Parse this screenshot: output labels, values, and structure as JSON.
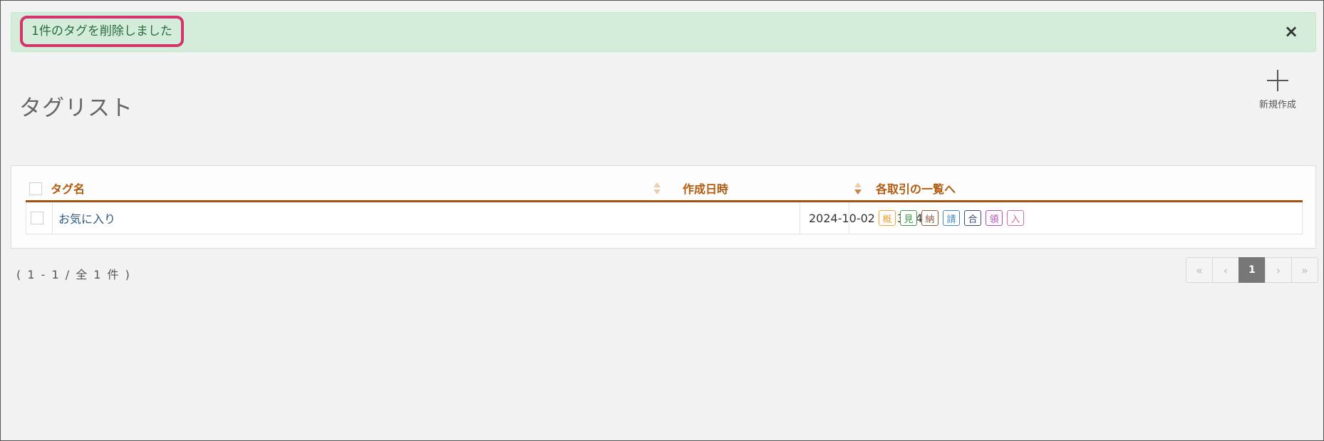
{
  "alert": {
    "message": "1件のタグを削除しました",
    "close": "×"
  },
  "page": {
    "title": "タグリスト",
    "new_button_label": "新規作成"
  },
  "table": {
    "columns": [
      "タグ名",
      "作成日時",
      "各取引の一覧へ"
    ],
    "rows": [
      {
        "name": "お気に入り",
        "created": "2024-10-02 13:37:41",
        "badges": [
          {
            "label": "概",
            "color": "#f0a13a"
          },
          {
            "label": "見",
            "color": "#3f9a4a"
          },
          {
            "label": "納",
            "color": "#8a5a3c"
          },
          {
            "label": "請",
            "color": "#3f86c9"
          },
          {
            "label": "合",
            "color": "#35507a"
          },
          {
            "label": "領",
            "color": "#b04bc0"
          },
          {
            "label": "入",
            "color": "#e06a93"
          }
        ]
      }
    ]
  },
  "footer": {
    "count": "( 1 - 1 / 全 1 件 )"
  },
  "pagination": {
    "first": "«",
    "prev": "‹",
    "current": "1",
    "next": "›",
    "last": "»"
  }
}
